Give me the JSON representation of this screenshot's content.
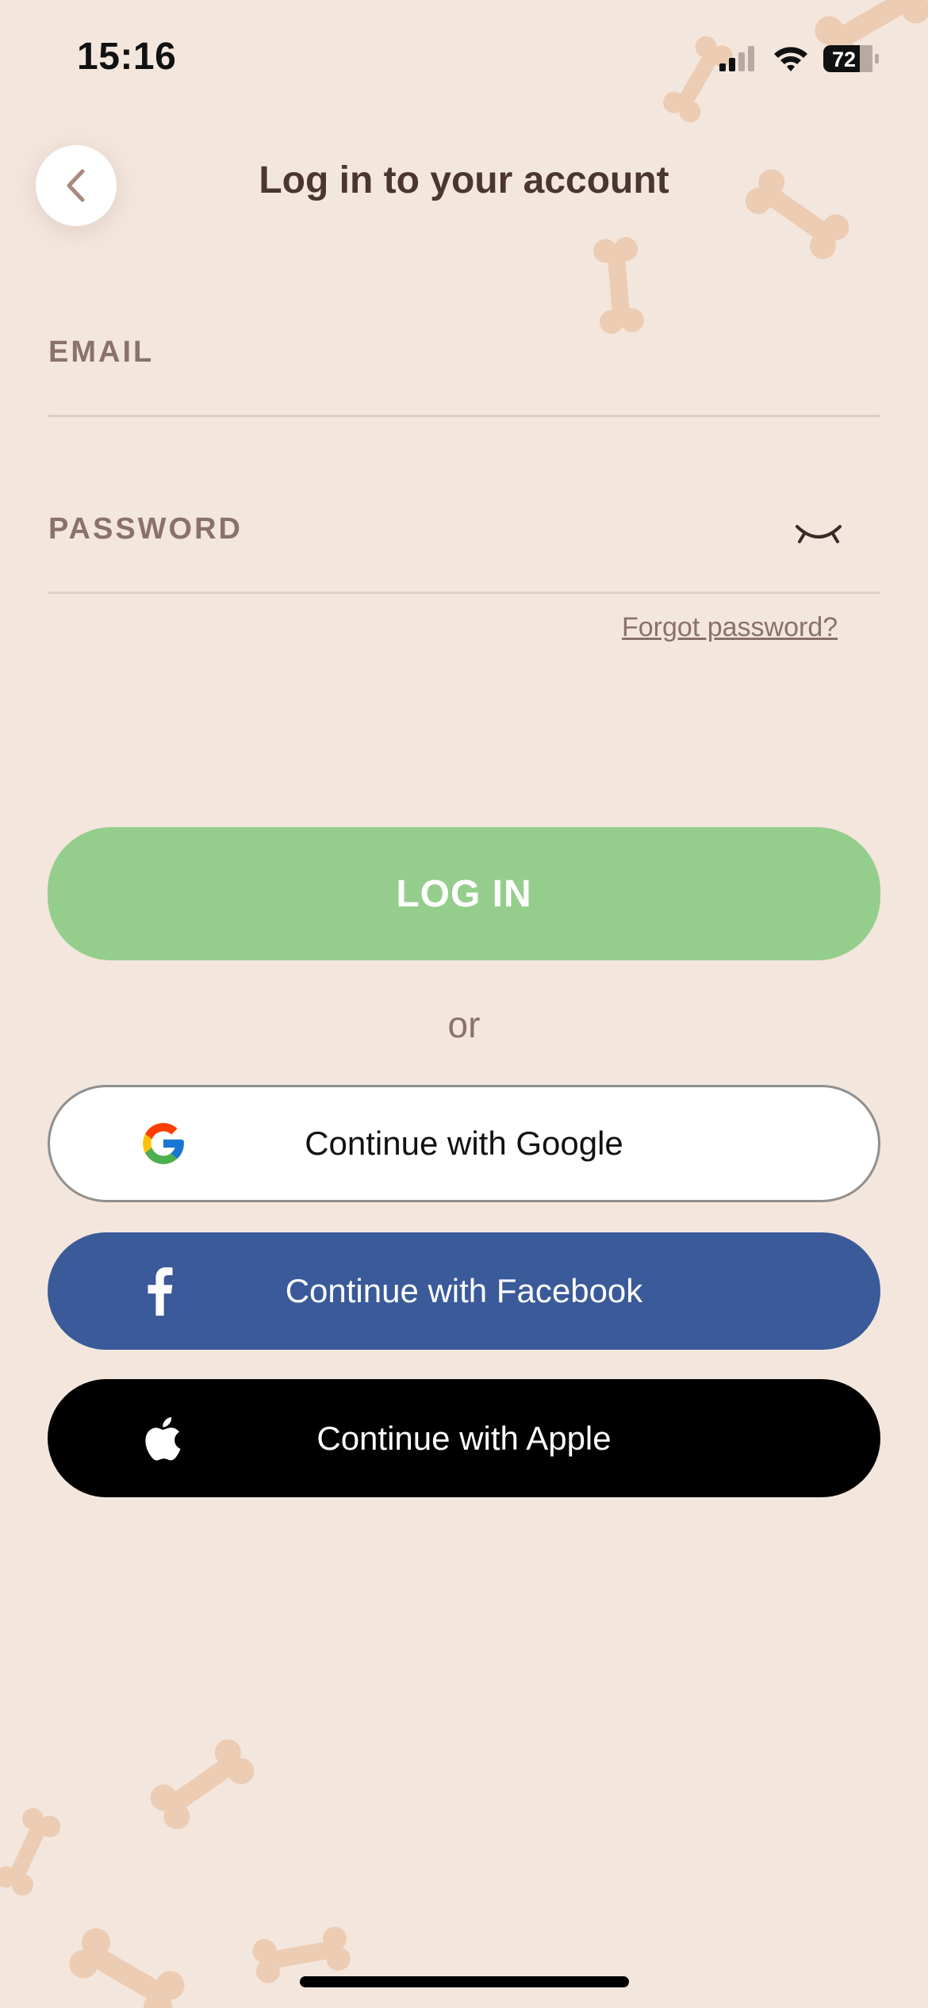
{
  "status_bar": {
    "time": "15:16",
    "battery": "72"
  },
  "header": {
    "title": "Log in to your account"
  },
  "form": {
    "email_label": "EMAIL",
    "password_label": "PASSWORD",
    "forgot_password": "Forgot password?"
  },
  "actions": {
    "login_label": "LOG IN",
    "or_text": "or",
    "google_label": "Continue with Google",
    "facebook_label": "Continue with Facebook",
    "apple_label": "Continue with Apple"
  },
  "icons": {
    "back": "chevron-left-icon",
    "password_toggle": "eye-closed-icon",
    "google": "google-icon",
    "facebook": "facebook-icon",
    "apple": "apple-icon"
  },
  "colors": {
    "background": "#f3e6dd",
    "login_button": "#95ce8c",
    "facebook_button": "#3a5a99",
    "apple_button": "#000000",
    "title_text": "#4a3530",
    "muted_text": "#8a7269",
    "decor_bones": "#ecccb3"
  }
}
